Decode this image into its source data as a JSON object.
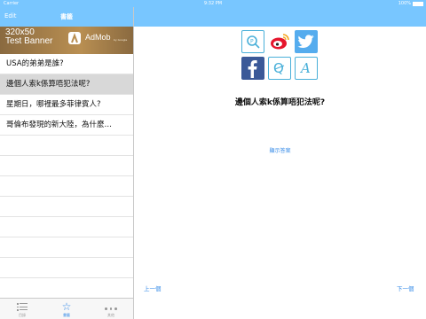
{
  "status_bar": {
    "carrier": "Carrier",
    "time": "9:32 PM",
    "battery": "100%"
  },
  "master": {
    "edit_label": "Edit",
    "title": "書籤",
    "ad": {
      "size_text": "320x50",
      "sub_text": "Test Banner",
      "brand": "AdMob",
      "by_text": "by Google"
    },
    "items": [
      {
        "label": "USA的弟弟是誰?",
        "selected": false
      },
      {
        "label": "邊個人索k係算唔犯法呢?",
        "selected": true
      },
      {
        "label": "星期日，哪裡最多菲律賓人?",
        "selected": false
      },
      {
        "label": "哥倫布發現的新大陸，為什麼…",
        "selected": false
      }
    ],
    "tabs": [
      {
        "label": "目錄",
        "icon": "list-icon",
        "active": false
      },
      {
        "label": "書籤",
        "icon": "star-icon",
        "active": true
      },
      {
        "label": "其他",
        "icon": "more-icon",
        "active": false
      }
    ]
  },
  "detail": {
    "share_icons": [
      "plus-app-icon",
      "weibo-icon",
      "twitter-icon",
      "facebook-icon",
      "qzone-icon",
      "a-app-icon"
    ],
    "question": "邊個人索k係算唔犯法呢?",
    "show_answer_label": "顯示答案",
    "prev_label": "上一個",
    "next_label": "下一個"
  },
  "colors": {
    "nav_blue": "#78c6ff",
    "link_blue": "#3a8de8",
    "selected_row": "#d8d8d8"
  }
}
